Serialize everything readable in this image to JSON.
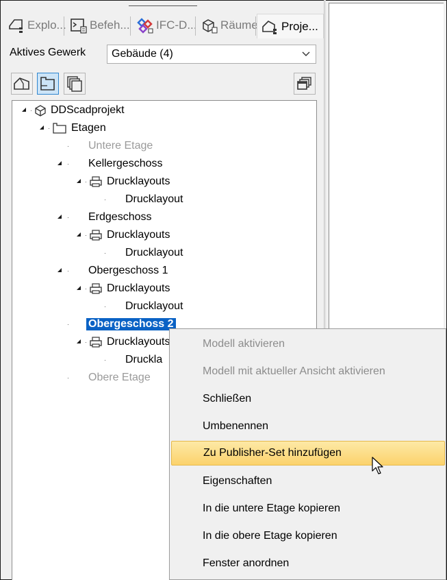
{
  "tabs": [
    {
      "label": "Explo...",
      "icon": "explorer-icon",
      "active": false
    },
    {
      "label": "Befeh...",
      "icon": "command-icon",
      "active": false
    },
    {
      "label": "IFC-D...",
      "icon": "ifc-icon",
      "active": false
    },
    {
      "label": "Räume",
      "icon": "rooms-icon",
      "active": false
    },
    {
      "label": "Proje...",
      "icon": "project-icon",
      "active": true
    }
  ],
  "gewerk": {
    "label": "Aktives Gewerk",
    "value": "Gebäude (4)"
  },
  "toolbar": {
    "buttons": [
      "building-view-icon",
      "floor-view-icon",
      "layouts-view-icon"
    ],
    "right": "window-arrange-icon"
  },
  "tree": {
    "root": "DDScadprojekt",
    "etagen": "Etagen",
    "untere": "Untere Etage",
    "keller": "Kellergeschoss",
    "drucklayouts": "Drucklayouts",
    "drucklayout": "Drucklayout",
    "erd": "Erdgeschoss",
    "og1": "Obergeschoss 1",
    "og2": "Obergeschoss 2",
    "drucklay_trunc": "Druckla",
    "obere": "Obere Etage"
  },
  "context_menu": [
    {
      "label": "Modell aktivieren",
      "disabled": true
    },
    {
      "label": "Modell mit aktueller Ansicht aktivieren",
      "disabled": true
    },
    {
      "label": "Schließen",
      "disabled": false
    },
    {
      "label": "Umbenennen",
      "disabled": false
    },
    {
      "label": "Zu Publisher-Set hinzufügen",
      "disabled": false,
      "hover": true
    },
    {
      "label": "Eigenschaften",
      "disabled": false
    },
    {
      "label": "In die untere Etage kopieren",
      "disabled": false
    },
    {
      "label": "In die obere Etage kopieren",
      "disabled": false
    },
    {
      "label": "Fenster anordnen",
      "disabled": false
    }
  ],
  "colors": {
    "selection": "#0a62c5",
    "hover_top": "#fde9a6",
    "hover_bottom": "#fbd26c"
  }
}
